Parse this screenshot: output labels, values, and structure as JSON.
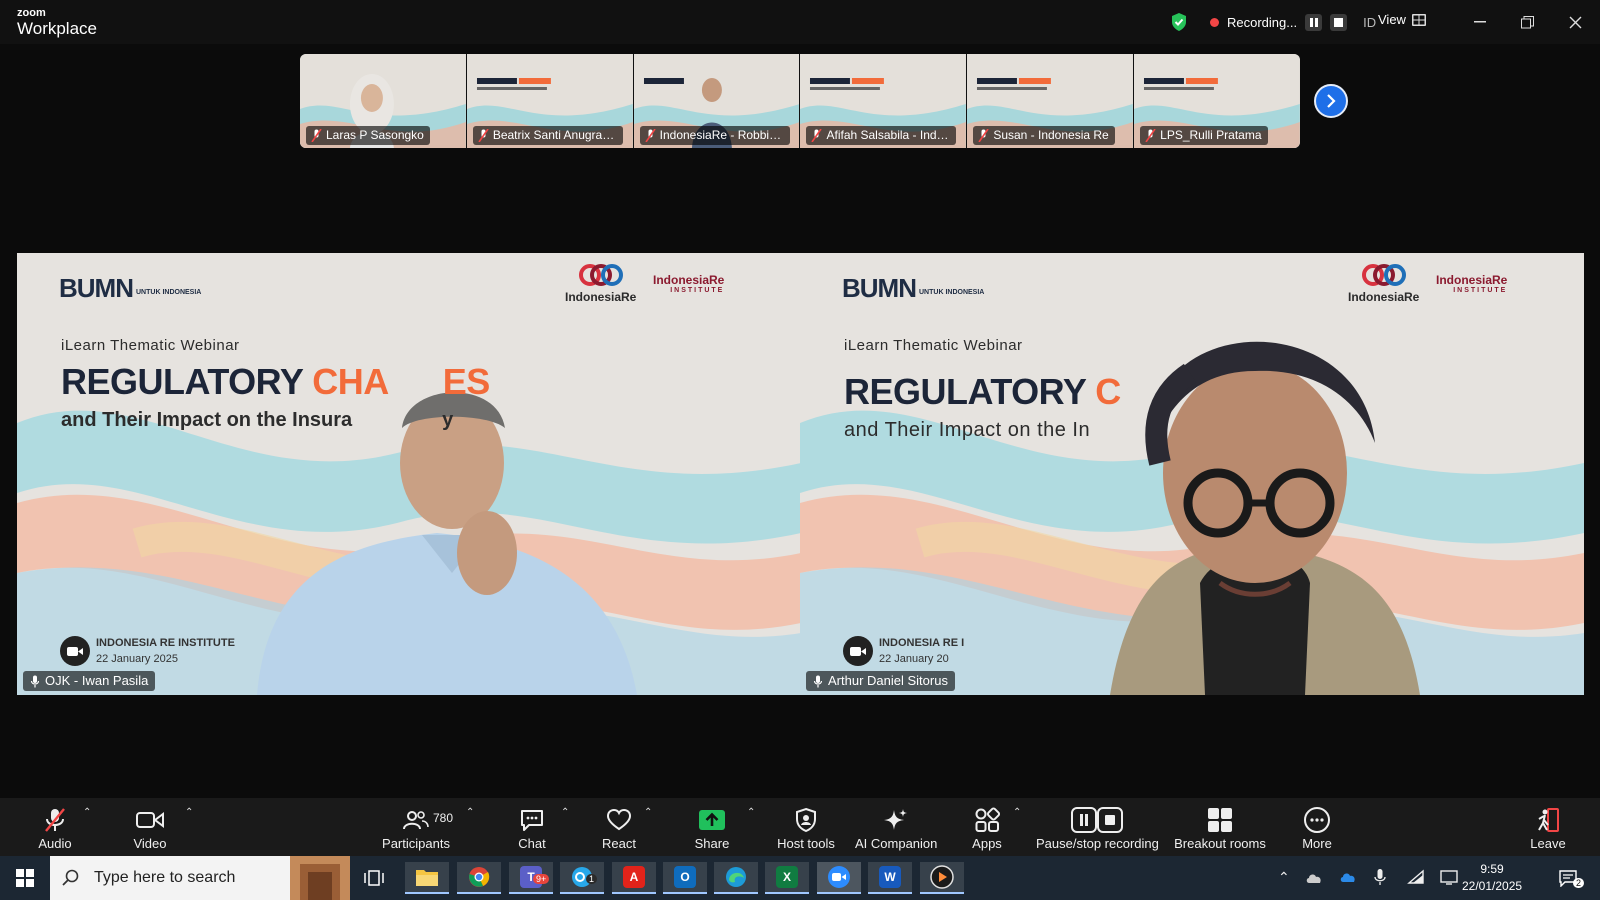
{
  "app": {
    "brand_small": "zoom",
    "brand_name": "Workplace"
  },
  "recording": {
    "status": "Recording...",
    "lang": "ID",
    "view_label": "View"
  },
  "thumbnails": [
    {
      "name": "Laras P Sasongko"
    },
    {
      "name": "Beatrix Santi Anugrah_..."
    },
    {
      "name": "IndonesiaRe - Robbi W..."
    },
    {
      "name": "Afifah Salsabila - Indo..."
    },
    {
      "name": "Susan - Indonesia Re"
    },
    {
      "name": "LPS_Rulli Pratama"
    }
  ],
  "slide": {
    "bumn": "BUMN",
    "bumn_small": "UNTUK INDONESIA",
    "logo_a": "IndonesiaRe",
    "logo_b": "IndonesiaRe",
    "logo_b_sub": "INSTITUTE",
    "webinar": "iLearn Thematic Webinar",
    "title_dark": "REGULATORY",
    "left_title_orange": "CHA",
    "left_title_orange_tail": "ES",
    "left_subtitle_a": "and Their Impact on the Insura",
    "left_subtitle_b": "y",
    "right_title_orange": "C",
    "right_subtitle": "and Their Impact on the In",
    "left_institute": "INDONESIA RE INSTITUTE",
    "right_institute": "INDONESIA RE I",
    "left_date": "22 January 2025",
    "right_date": "22 January 20",
    "thumb_title": "REGULATORY CHANGES",
    "thumb_sub": "and Their Impact on the Insurance Industry",
    "thumb_small": "iLearn Thematic Webinar"
  },
  "speakers": {
    "left": "OJK - Iwan Pasila",
    "right": "Arthur Daniel Sitorus"
  },
  "toolbar": {
    "audio": "Audio",
    "video": "Video",
    "participants": "Participants",
    "participants_count": "780",
    "chat": "Chat",
    "react": "React",
    "share": "Share",
    "host_tools": "Host tools",
    "ai_companion": "AI Companion",
    "apps": "Apps",
    "pause_stop": "Pause/stop recording",
    "breakout": "Breakout rooms",
    "more": "More",
    "leave": "Leave"
  },
  "taskbar": {
    "search_placeholder": "Type here to search",
    "teams_badge": "9+",
    "outlook_badge": "1",
    "time": "9:59",
    "date": "22/01/2025",
    "notif_count": "2"
  },
  "colors": {
    "accent_green": "#2dd36a",
    "recording_red": "#f24646",
    "share_green": "#20c05c",
    "brand_orange": "#f26b3a"
  }
}
